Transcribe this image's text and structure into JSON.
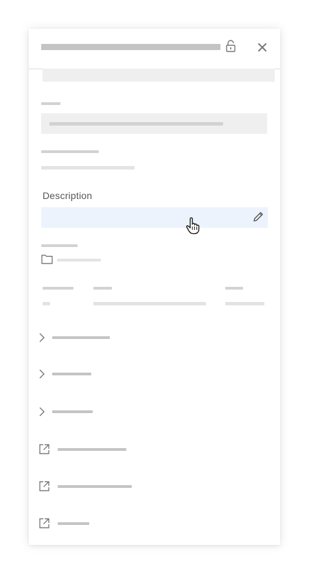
{
  "panel": {
    "description_label": "Description",
    "description_value": ""
  },
  "icons": {
    "lock": "lock-open-icon",
    "close": "close-icon",
    "edit": "pencil-icon",
    "cursor": "hand-pointer-cursor",
    "folder": "folder-icon",
    "expand": "chevron-right-icon",
    "open_external": "external-link-icon"
  },
  "colors": {
    "field_highlight": "#edf3fc",
    "placeholder_bar": "#e3e3e3",
    "title_bar": "#c4c4c4",
    "label_text": "#555555"
  }
}
